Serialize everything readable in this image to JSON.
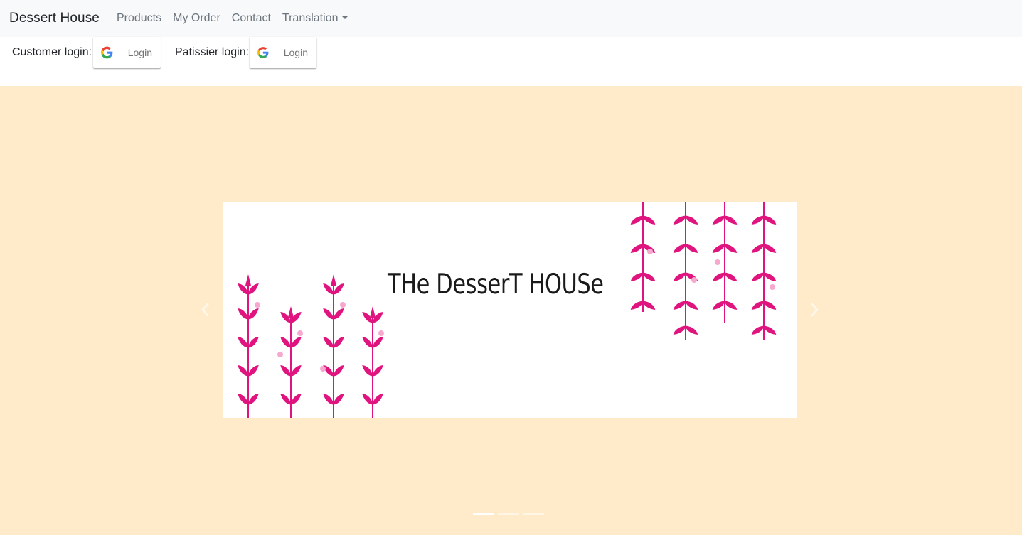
{
  "nav": {
    "brand": "Dessert House",
    "links": [
      "Products",
      "My Order",
      "Contact"
    ],
    "dropdown_label": "Translation"
  },
  "login": {
    "customer_label": "Customer login:",
    "patissier_label": "Patissier login:",
    "button_text": "Login",
    "icon": "google-icon"
  },
  "carousel": {
    "background": "#ffebc9",
    "slide_title": "THe DesserT HOUSe",
    "prev_icon": "chevron-left-icon",
    "next_icon": "chevron-right-icon",
    "indicator_count": 3,
    "active_indicator": 1,
    "accent": "#e0147f"
  }
}
